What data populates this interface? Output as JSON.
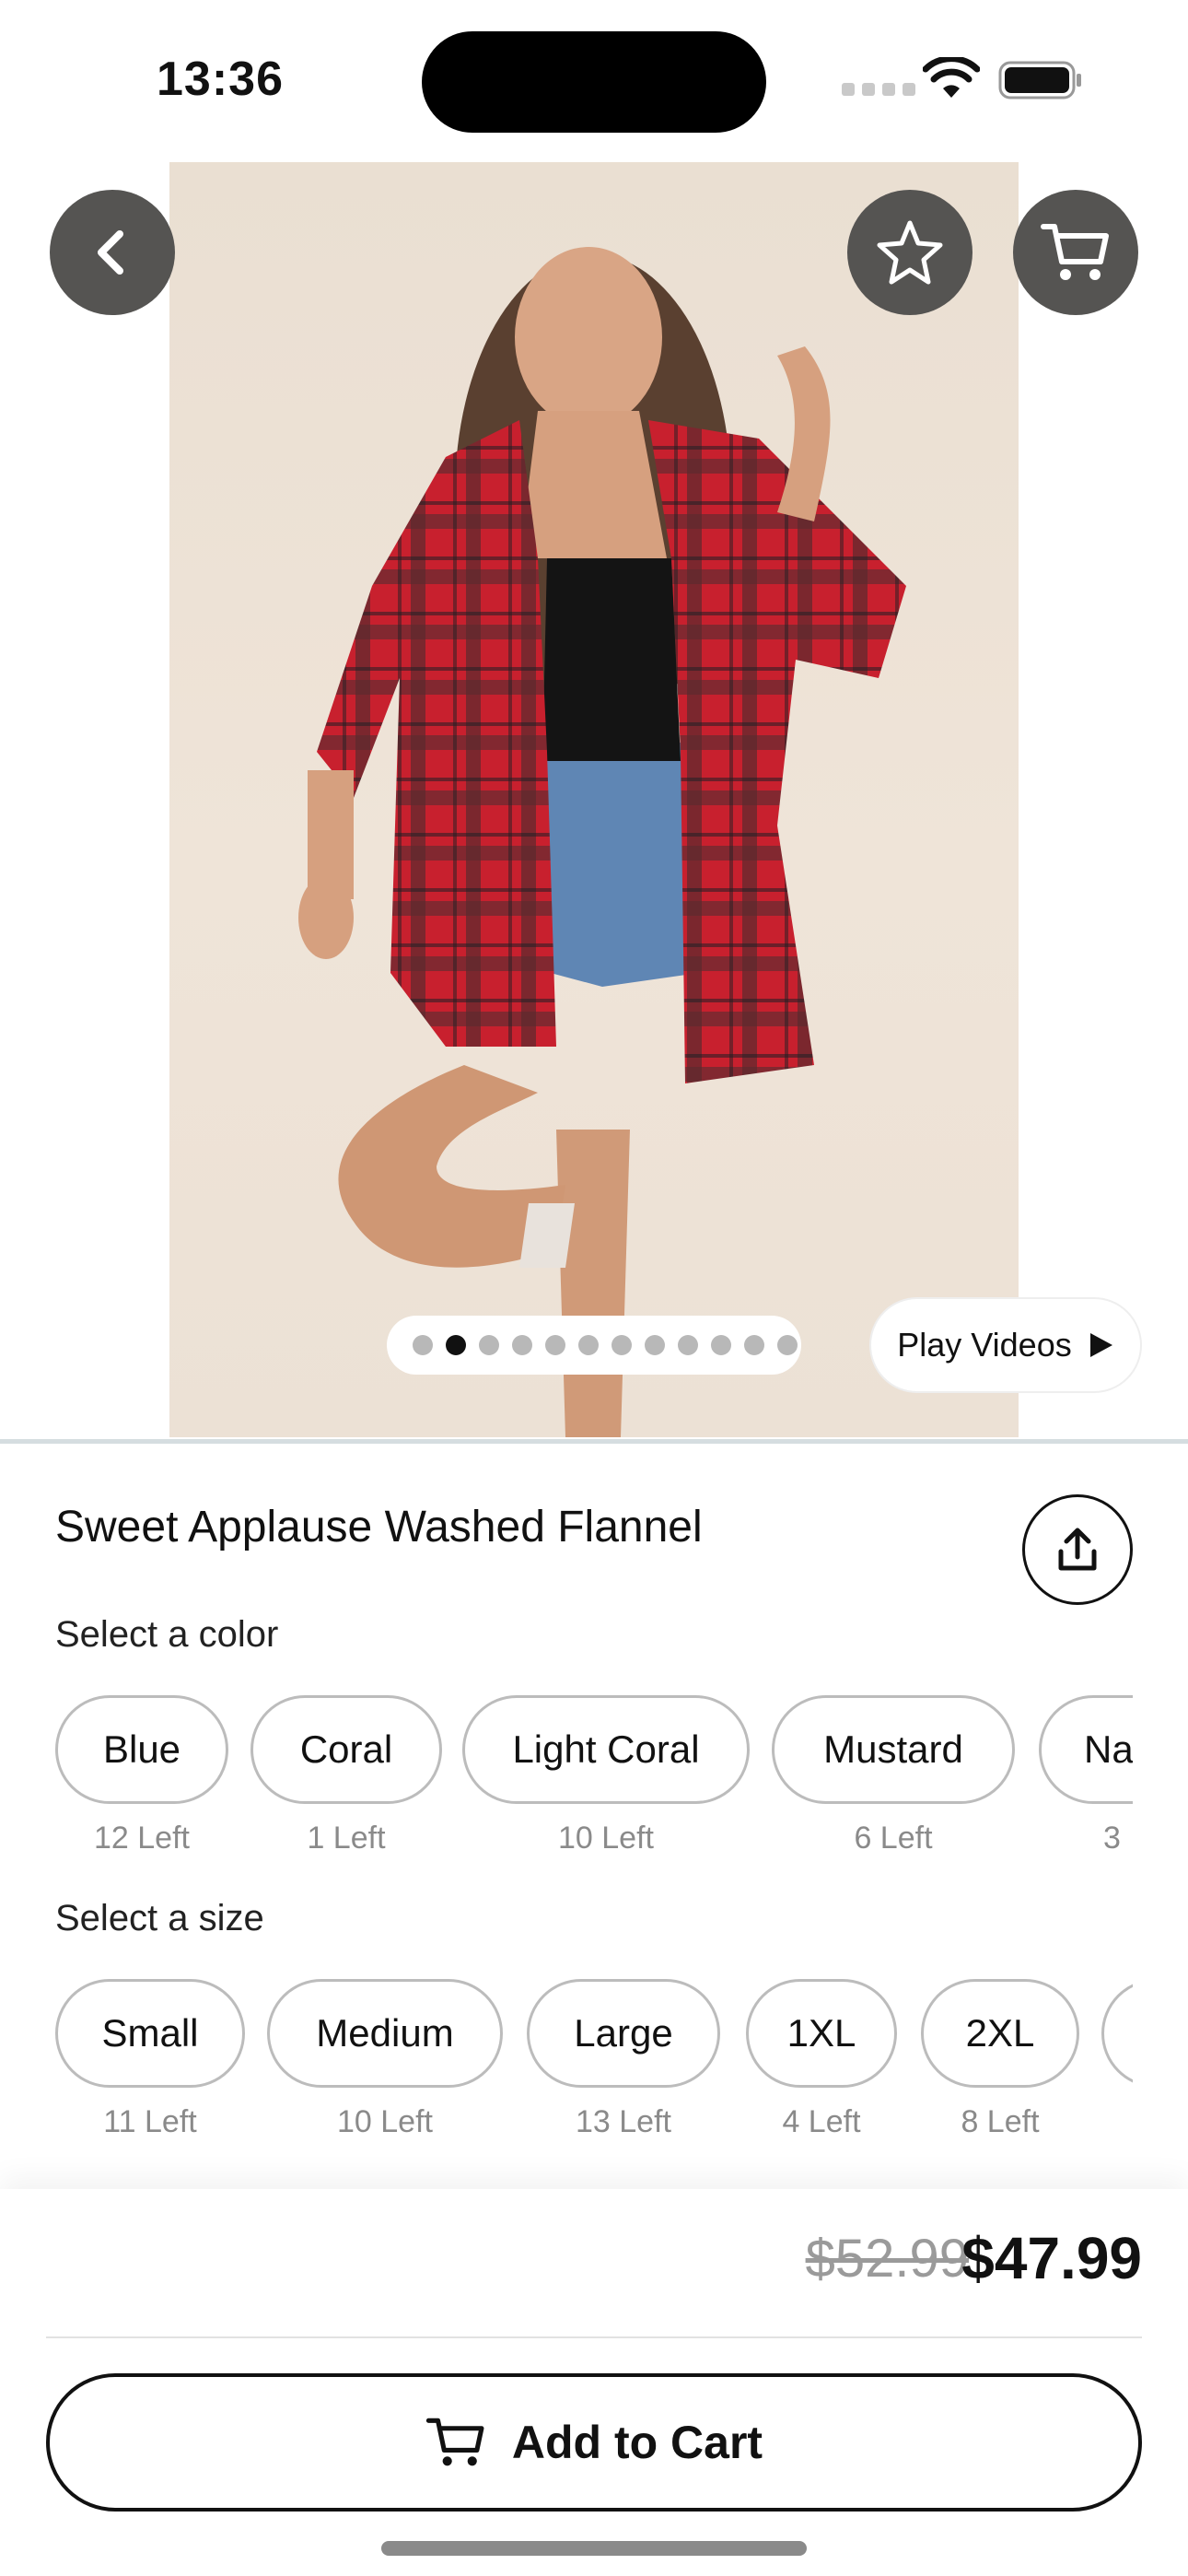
{
  "status_bar": {
    "time": "13:36"
  },
  "product": {
    "title": "Sweet Applause Washed Flannel",
    "image_count": 12,
    "active_image_index": 1,
    "play_videos_label": "Play Videos"
  },
  "color_section": {
    "label": "Select a color",
    "options": [
      {
        "name": "Blue",
        "stock": "12 Left"
      },
      {
        "name": "Coral",
        "stock": "1 Left"
      },
      {
        "name": "Light Coral",
        "stock": "10 Left"
      },
      {
        "name": "Mustard",
        "stock": "6 Left"
      },
      {
        "name": "Na",
        "stock": "3"
      }
    ]
  },
  "size_section": {
    "label": "Select a size",
    "options": [
      {
        "name": "Small",
        "stock": "11 Left"
      },
      {
        "name": "Medium",
        "stock": "10 Left"
      },
      {
        "name": "Large",
        "stock": "13 Left"
      },
      {
        "name": "1XL",
        "stock": "4 Left"
      },
      {
        "name": "2XL",
        "stock": "8 Left"
      },
      {
        "name": "",
        "stock": ""
      }
    ]
  },
  "pricing": {
    "original": "$52.99",
    "sale": "$47.99"
  },
  "actions": {
    "add_to_cart_label": "Add to Cart"
  },
  "icons": {
    "back": "chevron-left-icon",
    "favorite": "star-icon",
    "cart": "cart-icon",
    "share": "share-icon",
    "play": "play-icon"
  },
  "colors": {
    "overlay_button": "#555452",
    "pill_border": "#bcbcbc",
    "stock_text": "#8a8a8a"
  }
}
